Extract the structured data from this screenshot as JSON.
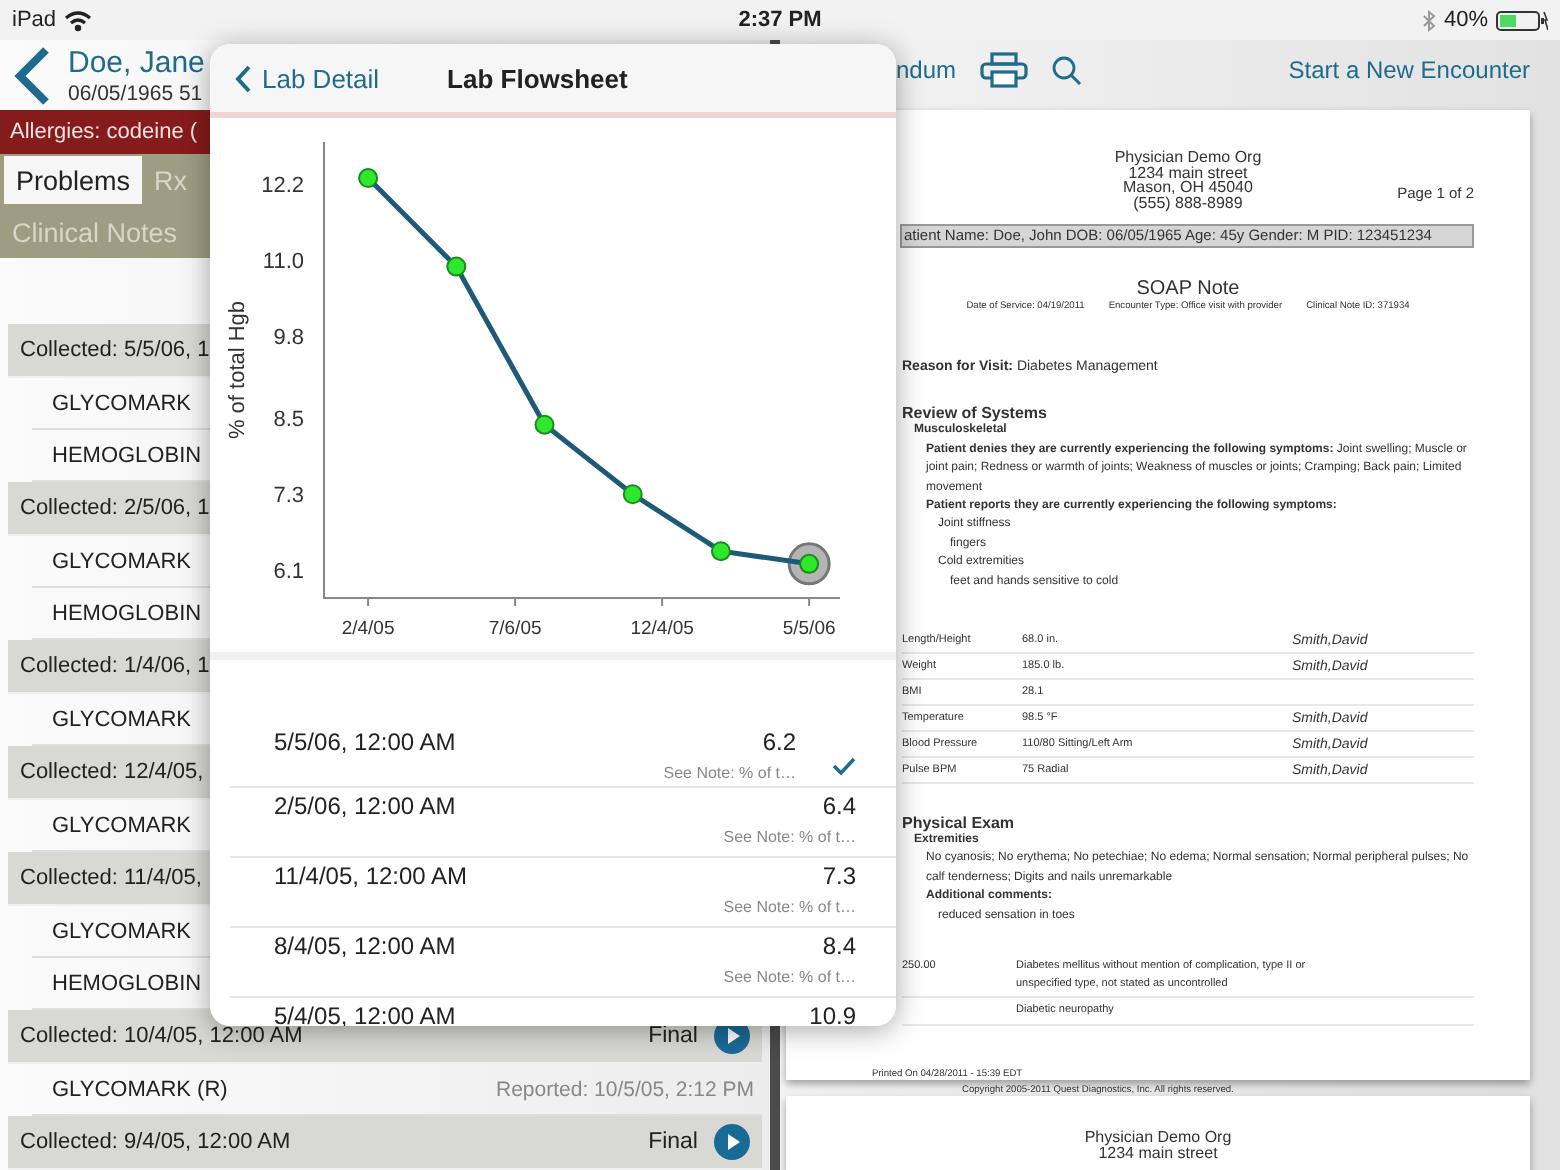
{
  "status_bar": {
    "device": "iPad",
    "time": "2:37 PM",
    "battery": "40%"
  },
  "patient_panel": {
    "name": "Doe, Jane",
    "dob_age": "06/05/1965  51",
    "allergies": "Allergies:  codeine (",
    "tab_rows": [
      [
        {
          "label": "Problems",
          "selected": true
        },
        {
          "label": "Rx",
          "selected": false
        }
      ],
      [
        {
          "label": "Clinical Notes",
          "selected": false
        }
      ]
    ],
    "labs": [
      {
        "collected": "Collected: 5/5/06, 1",
        "results": [
          {
            "name": "GLYCOMARK"
          },
          {
            "name": "HEMOGLOBIN"
          }
        ]
      },
      {
        "collected": "Collected: 2/5/06, 1",
        "results": [
          {
            "name": "GLYCOMARK"
          },
          {
            "name": "HEMOGLOBIN"
          }
        ]
      },
      {
        "collected": "Collected: 1/4/06, 1",
        "results": [
          {
            "name": "GLYCOMARK"
          }
        ]
      },
      {
        "collected": "Collected: 12/4/05,",
        "results": [
          {
            "name": "GLYCOMARK"
          }
        ]
      },
      {
        "collected": "Collected: 11/4/05,",
        "results": [
          {
            "name": "GLYCOMARK"
          },
          {
            "name": "HEMOGLOBIN"
          }
        ]
      },
      {
        "collected": "Collected: 10/4/05, 12:00 AM",
        "status": "Final",
        "results": [
          {
            "name": "GLYCOMARK (R)",
            "reported": "Reported: 10/5/05, 2:12 PM"
          }
        ]
      },
      {
        "collected": "Collected: 9/4/05, 12:00 AM",
        "status": "Final"
      }
    ]
  },
  "toolbar": {
    "addendum": "ndum",
    "new_encounter": "Start a New Encounter"
  },
  "document": {
    "org_lines": [
      "Physician Demo Org",
      "1234 main street",
      "Mason, OH 45040",
      "(555) 888-8989"
    ],
    "page_label": "Page 1 of 2",
    "patient_bar": "atient Name: Doe, John  DOB: 06/05/1965  Age: 45y   Gender: M   PID: 123451234",
    "title": "SOAP Note",
    "meta": [
      "Date of Service: 04/19/2011",
      "Encounter Type: Office visit with provider",
      "Clinical Note ID: 371934"
    ],
    "reason": "**Reason for Visit:** Diabetes Management",
    "review": {
      "heading": "Review of Systems",
      "lines": [
        {
          "kind": "sub",
          "text": "Musculoskeletal"
        },
        {
          "kind": "para",
          "text": "**Patient denies they are currently experiencing the following symptoms:** Joint swelling; Muscle or joint pain; Redness or warmth of joints; Weakness of muscles or joints; Cramping; Back pain; Limited movement"
        },
        {
          "kind": "bold",
          "text": "Patient reports they are currently experiencing the following symptoms:"
        },
        {
          "kind": "item",
          "text": "Joint stiffness"
        },
        {
          "kind": "subitem",
          "text": "fingers"
        },
        {
          "kind": "item",
          "text": "Cold extremities"
        },
        {
          "kind": "subitem",
          "text": "feet and hands sensitive to cold"
        }
      ]
    },
    "vitals": [
      {
        "name": "Length/Height",
        "value": "68.0 in.",
        "by": "Smith,David"
      },
      {
        "name": "Weight",
        "value": "185.0 lb.",
        "by": "Smith,David"
      },
      {
        "name": "BMI",
        "value": "28.1"
      },
      {
        "name": "Temperature",
        "value": "98.5 °F",
        "by": "Smith,David"
      },
      {
        "name": "Blood Pressure",
        "value": "110/80  Sitting/Left Arm",
        "by": "Smith,David"
      },
      {
        "name": "Pulse BPM",
        "value": "75 Radial",
        "by": "Smith,David"
      }
    ],
    "exam": {
      "heading": "Physical Exam",
      "lines": [
        {
          "kind": "sub",
          "text": "Extremities"
        },
        {
          "kind": "para",
          "text": "No cyanosis; No erythema; No petechiae; No edema; Normal sensation; Normal peripheral pulses; No calf tenderness; Digits and nails unremarkable"
        },
        {
          "kind": "bold",
          "text": "Additional comments:"
        },
        {
          "kind": "item",
          "text": "reduced sensation in toes"
        }
      ]
    },
    "diagnoses": [
      {
        "code": "250.00",
        "text": "Diabetes mellitus without mention of complication, type II or unspecified type, not stated as uncontrolled"
      },
      {
        "text": "Diabetic neuropathy"
      }
    ],
    "printed": "Printed On 04/28/2011 - 15:39 EDT",
    "copyright": "Copyright 2005-2011 Quest Diagnostics, Inc. All rights reserved.",
    "next_page_lines": [
      "Physician Demo Org",
      "1234 main street"
    ]
  },
  "popover": {
    "back": "Lab Detail",
    "title": "Lab Flowsheet",
    "intermediate_date_labels": [
      "7/6/05",
      "12/4/05"
    ],
    "chart_data": {
      "type": "line",
      "ylabel": "% of total Hgb",
      "categories": [
        "2/4/05",
        null,
        null,
        null,
        null,
        "5/5/06"
      ],
      "ylim": [
        5.66,
        12.87
      ],
      "yticks": [
        {
          "value": 6.1,
          "label": "6.1"
        },
        {
          "value": 7.3,
          "label": "7.3"
        },
        {
          "value": 8.5,
          "label": "8.5"
        },
        {
          "value": 9.8,
          "label": "9.8"
        },
        {
          "value": 11,
          "label": "11.0"
        },
        {
          "value": 12.2,
          "label": "12.2"
        }
      ],
      "series": [
        {
          "color": "#1d5a78",
          "marker": "circle",
          "values": [
            12.3,
            10.9,
            8.4,
            7.3,
            6.4,
            6.2
          ]
        }
      ]
    },
    "readings": [
      {
        "date": "5/5/06, 12:00 AM",
        "value": "6.2",
        "note": "See Note: % of t…",
        "selected": true
      },
      {
        "date": "2/5/06, 12:00 AM",
        "value": "6.4",
        "note": "See Note: % of t…",
        "selected": false
      },
      {
        "date": "11/4/05, 12:00 AM",
        "value": "7.3",
        "note": "See Note: % of t…",
        "selected": false
      },
      {
        "date": "8/4/05, 12:00 AM",
        "value": "8.4",
        "note": "See Note: % of t…",
        "selected": false
      },
      {
        "date": "5/4/05, 12:00 AM",
        "value": "10.9",
        "selected": false
      }
    ]
  }
}
